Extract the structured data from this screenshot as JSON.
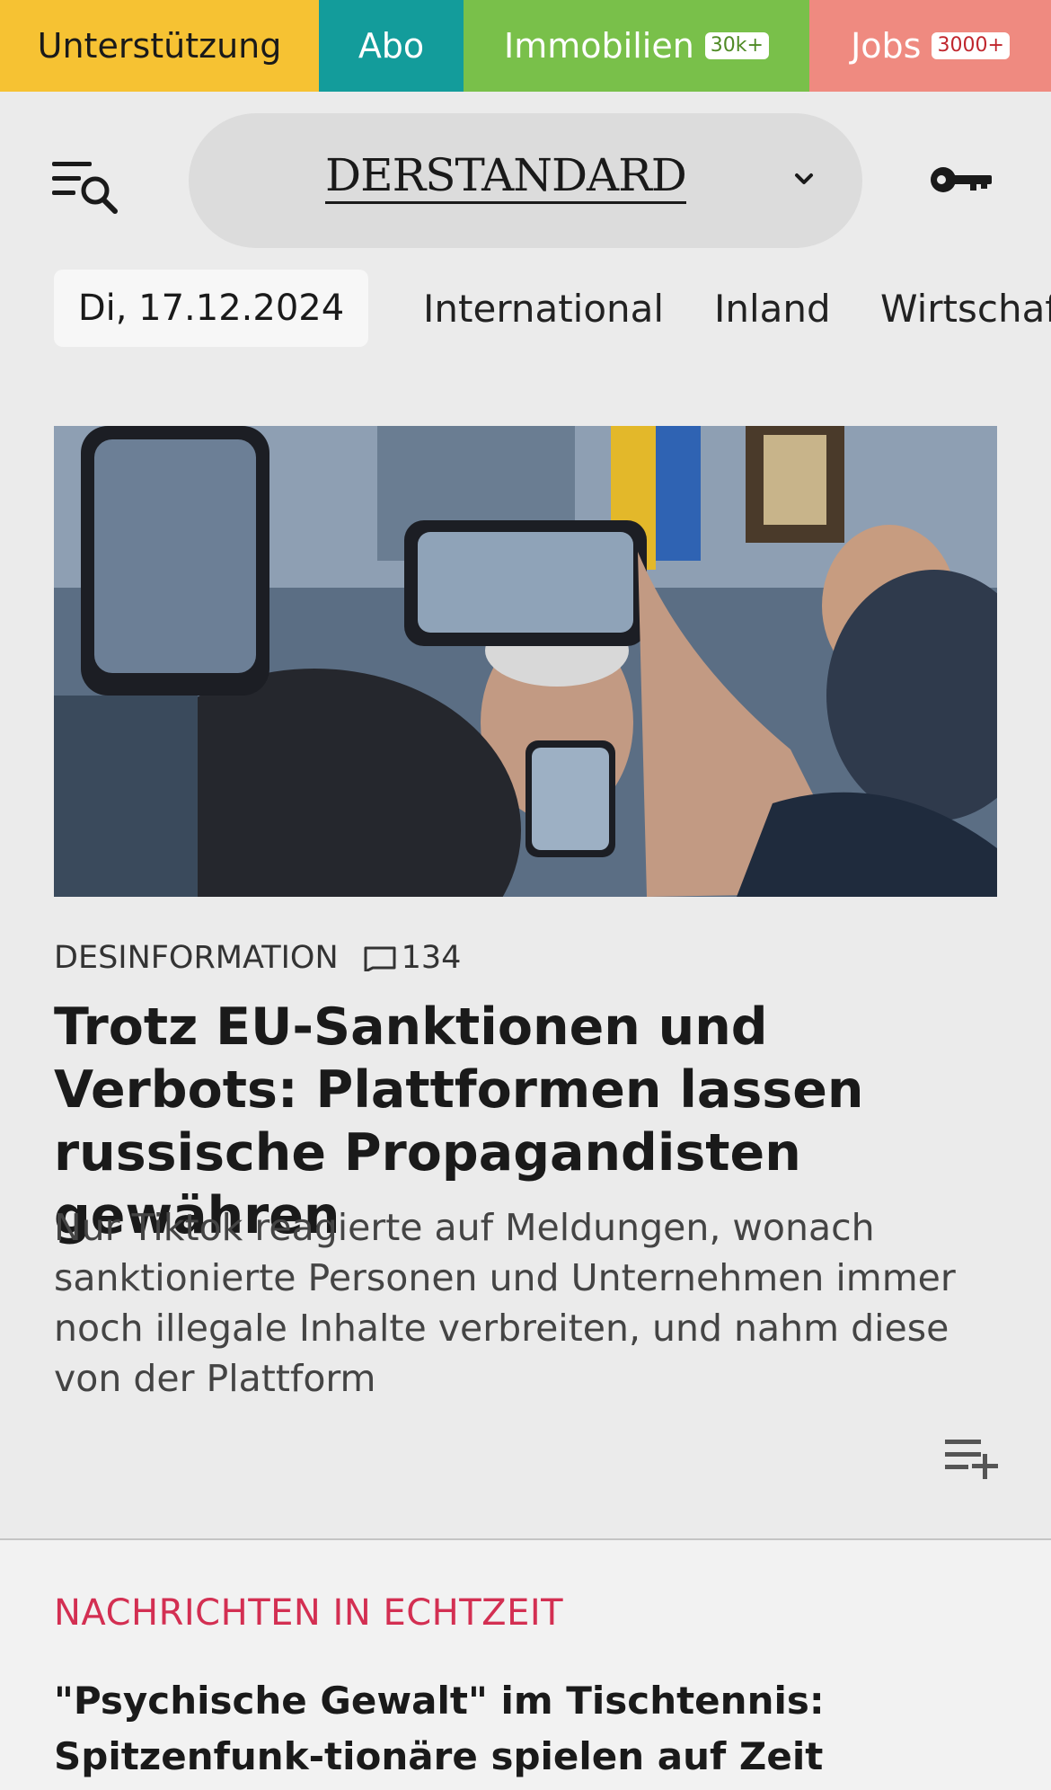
{
  "topbar": {
    "support": "Unterstützung",
    "abo": "Abo",
    "immobilien": "Immobilien",
    "immobilien_badge": "30k+",
    "jobs": "Jobs",
    "jobs_badge": "3000+"
  },
  "header": {
    "logo": "DERSTANDARD"
  },
  "nav": {
    "date": "Di, 17.12.2024",
    "items": [
      "International",
      "Inland",
      "Wirtschaft"
    ]
  },
  "article": {
    "kicker": "DESINFORMATION",
    "comments": "134",
    "headline": "Trotz EU-Sanktionen und Verbots: Plattformen lassen russische Propagandisten gewähren",
    "teaser": "Nur Tiktok reagierte auf Meldungen, wonach sanktionierte Personen und Unternehmen immer noch illegale Inhalte verbreiten, und nahm diese von der Plattform"
  },
  "live": {
    "section_title": "NACHRICHTEN IN ECHTZEIT",
    "headline": "\"Psychische Gewalt\" im Tischtennis: Spitzenfunk-tionäre spielen auf Zeit"
  },
  "colors": {
    "support": "#f6c233",
    "abo": "#139c9b",
    "immobilien": "#79c04a",
    "jobs": "#ef8a80",
    "section_title": "#d32f52"
  }
}
